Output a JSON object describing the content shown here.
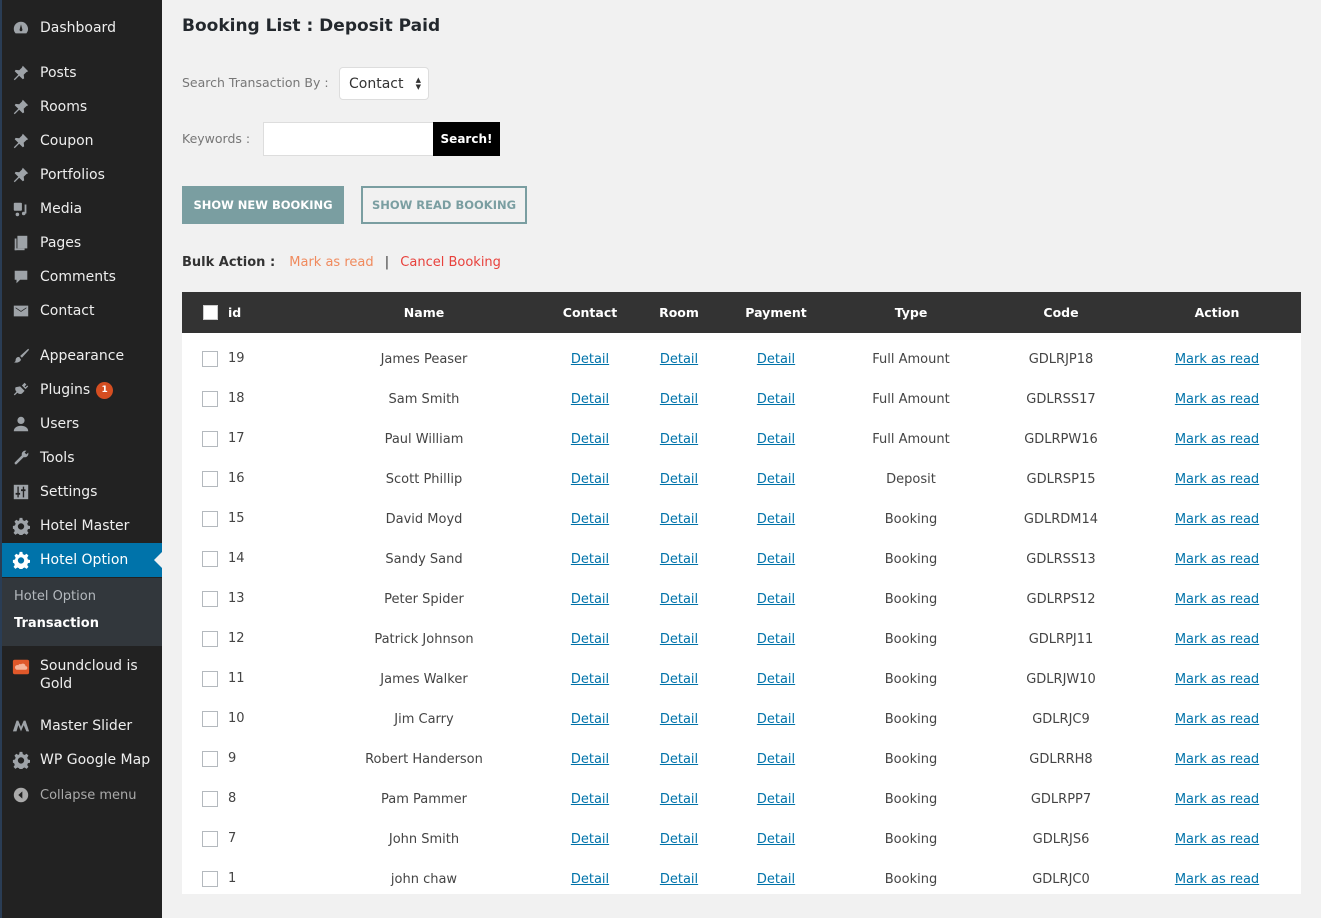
{
  "sidebar": {
    "items": [
      {
        "label": "Dashboard",
        "icon": "dashboard-icon"
      },
      {
        "label": "Posts",
        "icon": "pin-icon"
      },
      {
        "label": "Rooms",
        "icon": "pin-icon"
      },
      {
        "label": "Coupon",
        "icon": "pin-icon"
      },
      {
        "label": "Portfolios",
        "icon": "pin-icon"
      },
      {
        "label": "Media",
        "icon": "media-icon"
      },
      {
        "label": "Pages",
        "icon": "pages-icon"
      },
      {
        "label": "Comments",
        "icon": "comment-icon"
      },
      {
        "label": "Contact",
        "icon": "envelope-icon"
      },
      {
        "label": "Appearance",
        "icon": "brush-icon"
      },
      {
        "label": "Plugins",
        "icon": "plug-icon",
        "badge": "1"
      },
      {
        "label": "Users",
        "icon": "user-icon"
      },
      {
        "label": "Tools",
        "icon": "wrench-icon"
      },
      {
        "label": "Settings",
        "icon": "sliders-icon"
      },
      {
        "label": "Hotel Master",
        "icon": "gear-icon"
      },
      {
        "label": "Hotel Option",
        "icon": "gear-icon",
        "active": true
      },
      {
        "label": "Soundcloud is Gold",
        "icon": "soundcloud-icon"
      },
      {
        "label": "Master Slider",
        "icon": "master-slider-icon"
      },
      {
        "label": "WP Google Map",
        "icon": "gear-icon"
      }
    ],
    "submenu": [
      {
        "label": "Hotel Option"
      },
      {
        "label": "Transaction",
        "current": true
      }
    ],
    "collapse_label": "Collapse menu"
  },
  "main": {
    "title": "Booking List : Deposit Paid",
    "search_by_label": "Search Transaction By :",
    "search_by_value": "Contact",
    "keywords_label": "Keywords :",
    "keywords_value": "",
    "search_button": "Search!",
    "show_new_booking": "SHOW NEW BOOKING",
    "show_read_booking": "SHOW READ BOOKING",
    "bulk_action_label": "Bulk Action :",
    "bulk_mark_read": "Mark as read",
    "bulk_separator": "|",
    "bulk_cancel": "Cancel Booking",
    "colors": {
      "accent_button": "#7a9ea1",
      "mark_read": "#f08a5d",
      "cancel": "#e8413c",
      "link": "#0073aa",
      "sidebar_active": "#0073aa"
    }
  },
  "table": {
    "headers": {
      "id": "id",
      "name": "Name",
      "contact": "Contact",
      "room": "Room",
      "payment": "Payment",
      "type": "Type",
      "code": "Code",
      "action": "Action"
    },
    "link_label": "Detail",
    "action_label": "Mark as read",
    "rows": [
      {
        "id": "19",
        "name": "James Peaser",
        "type": "Full Amount",
        "code": "GDLRJP18"
      },
      {
        "id": "18",
        "name": "Sam Smith",
        "type": "Full Amount",
        "code": "GDLRSS17"
      },
      {
        "id": "17",
        "name": "Paul William",
        "type": "Full Amount",
        "code": "GDLRPW16"
      },
      {
        "id": "16",
        "name": "Scott Phillip",
        "type": "Deposit",
        "code": "GDLRSP15"
      },
      {
        "id": "15",
        "name": "David Moyd",
        "type": "Booking",
        "code": "GDLRDM14"
      },
      {
        "id": "14",
        "name": "Sandy Sand",
        "type": "Booking",
        "code": "GDLRSS13"
      },
      {
        "id": "13",
        "name": "Peter Spider",
        "type": "Booking",
        "code": "GDLRPS12"
      },
      {
        "id": "12",
        "name": "Patrick Johnson",
        "type": "Booking",
        "code": "GDLRPJ11"
      },
      {
        "id": "11",
        "name": "James Walker",
        "type": "Booking",
        "code": "GDLRJW10"
      },
      {
        "id": "10",
        "name": "Jim Carry",
        "type": "Booking",
        "code": "GDLRJC9"
      },
      {
        "id": "9",
        "name": "Robert Handerson",
        "type": "Booking",
        "code": "GDLRRH8"
      },
      {
        "id": "8",
        "name": "Pam Pammer",
        "type": "Booking",
        "code": "GDLRPP7"
      },
      {
        "id": "7",
        "name": "John Smith",
        "type": "Booking",
        "code": "GDLRJS6"
      },
      {
        "id": "1",
        "name": "john chaw",
        "type": "Booking",
        "code": "GDLRJC0"
      }
    ]
  }
}
